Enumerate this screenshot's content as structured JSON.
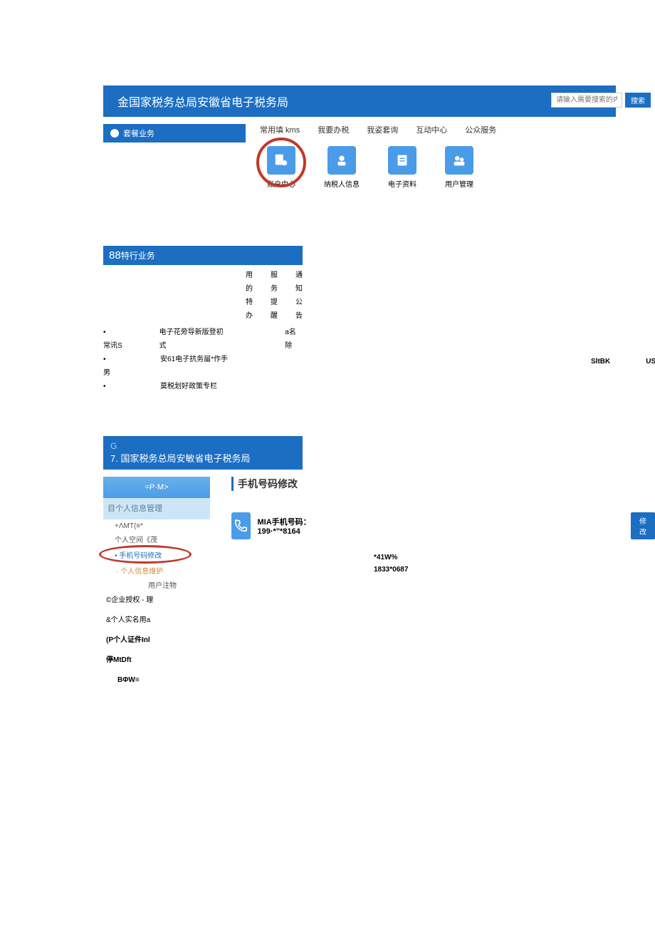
{
  "header": {
    "title": "金国家税务总局安徽省电子税务局"
  },
  "search": {
    "placeholder": "请输入需要搜索的内容",
    "button": "搜索"
  },
  "sidebar": {
    "label": "套餐业务"
  },
  "nav": {
    "tab1": "常用填 kms",
    "tab2": "我要办税",
    "tab3": "我姿套询",
    "tab4": "互动中心",
    "tab5": "公众服务"
  },
  "icons": {
    "item1": "账户中心",
    "item2": "纳税人信息",
    "item3": "电子资料",
    "item4": "用户管理"
  },
  "section2": {
    "banner_prefix": "88",
    "banner_suffix": "特行业务",
    "tab_a": "用的特办",
    "tab_b": "服务提醒",
    "tab_c": "通知公告",
    "line1_left": "常讯S",
    "line1_right": "电子花旁导新版登初式",
    "line2_sub": "a名除",
    "line3_left": "男",
    "line3_right": "安61电子抗务届*作手",
    "line4_right": "莫税划好政策专栏",
    "right_a": "SltBK",
    "right_b": "US"
  },
  "section3": {
    "header_g": "G",
    "header_title": "7. 国家税务总局安敏省电子税务局",
    "menu_top": "=P·M>",
    "menu_sub": "目个人信息管理",
    "m1": "+ΛMT(≡*",
    "m2": "个人空间《茂",
    "m3": "手机号码修改",
    "m4": "个人信息维护",
    "m5": "用户注物",
    "m6": "©企业授权 - 理",
    "m7": "&个人实名用a",
    "m8": "(P个人证件Inl",
    "m9": "停MtDft",
    "m10": "BΦW≡",
    "panel_title": "手机号码修改",
    "phone_label": "MIA手机号码：",
    "phone_value": "199·*\"*8164",
    "modify": "修改",
    "float1": "*41W%",
    "float2": "1833*0687"
  }
}
